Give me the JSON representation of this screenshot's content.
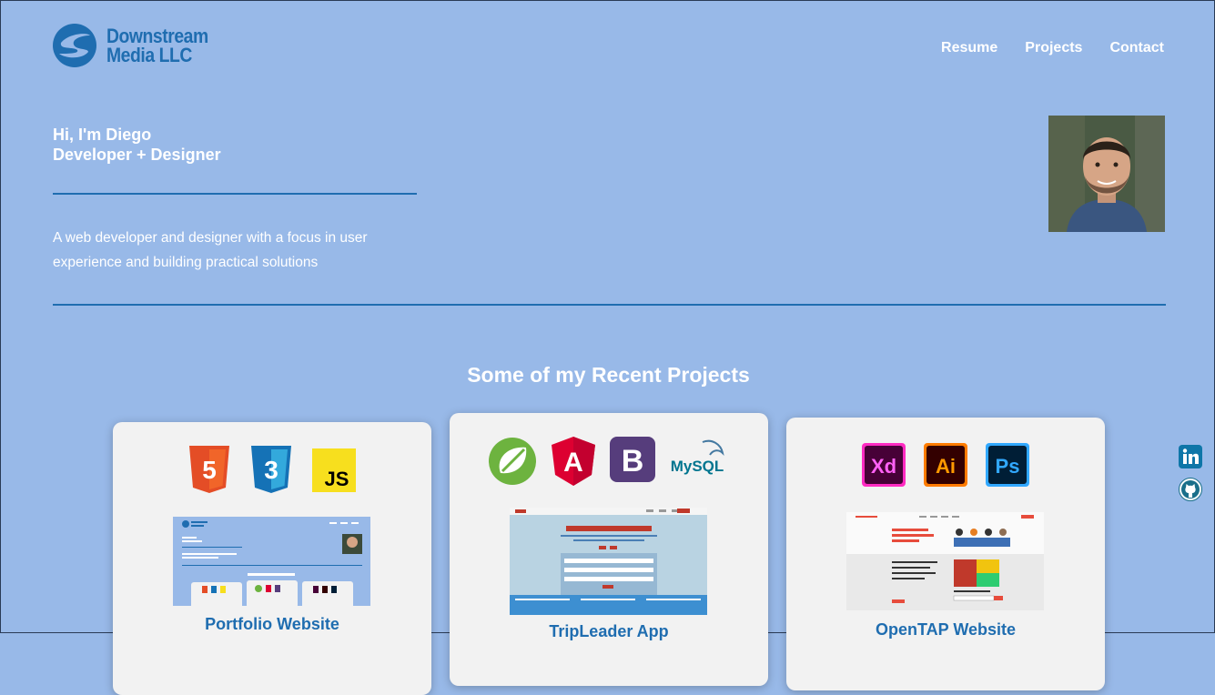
{
  "brand": {
    "line1": "Downstream",
    "line2": "Media LLC"
  },
  "nav": [
    {
      "label": "Resume"
    },
    {
      "label": "Projects"
    },
    {
      "label": "Contact"
    }
  ],
  "hero": {
    "greeting": "Hi, I'm Diego",
    "role": "Developer + Designer",
    "description": "A web developer and designer with a focus in user experience and building practical solutions"
  },
  "projects": {
    "heading": "Some of my Recent Projects",
    "cards": [
      {
        "title": "Portfolio Website",
        "icons": [
          "html5-icon",
          "css3-icon",
          "javascript-icon"
        ],
        "icon_labels": [
          "5",
          "3",
          "JS"
        ]
      },
      {
        "title": "TripLeader App",
        "icons": [
          "spring-icon",
          "angular-icon",
          "bootstrap-icon",
          "mysql-icon"
        ],
        "icon_labels": [
          "",
          "A",
          "B",
          "MySQL"
        ]
      },
      {
        "title": "OpenTAP Website",
        "icons": [
          "adobe-xd-icon",
          "illustrator-icon",
          "photoshop-icon"
        ],
        "icon_labels": [
          "Xd",
          "Ai",
          "Ps"
        ]
      }
    ]
  },
  "social": [
    "linkedin-icon",
    "github-icon"
  ],
  "colors": {
    "background": "#98b9e8",
    "accent": "#1f6db0",
    "card": "#f2f2f2"
  }
}
